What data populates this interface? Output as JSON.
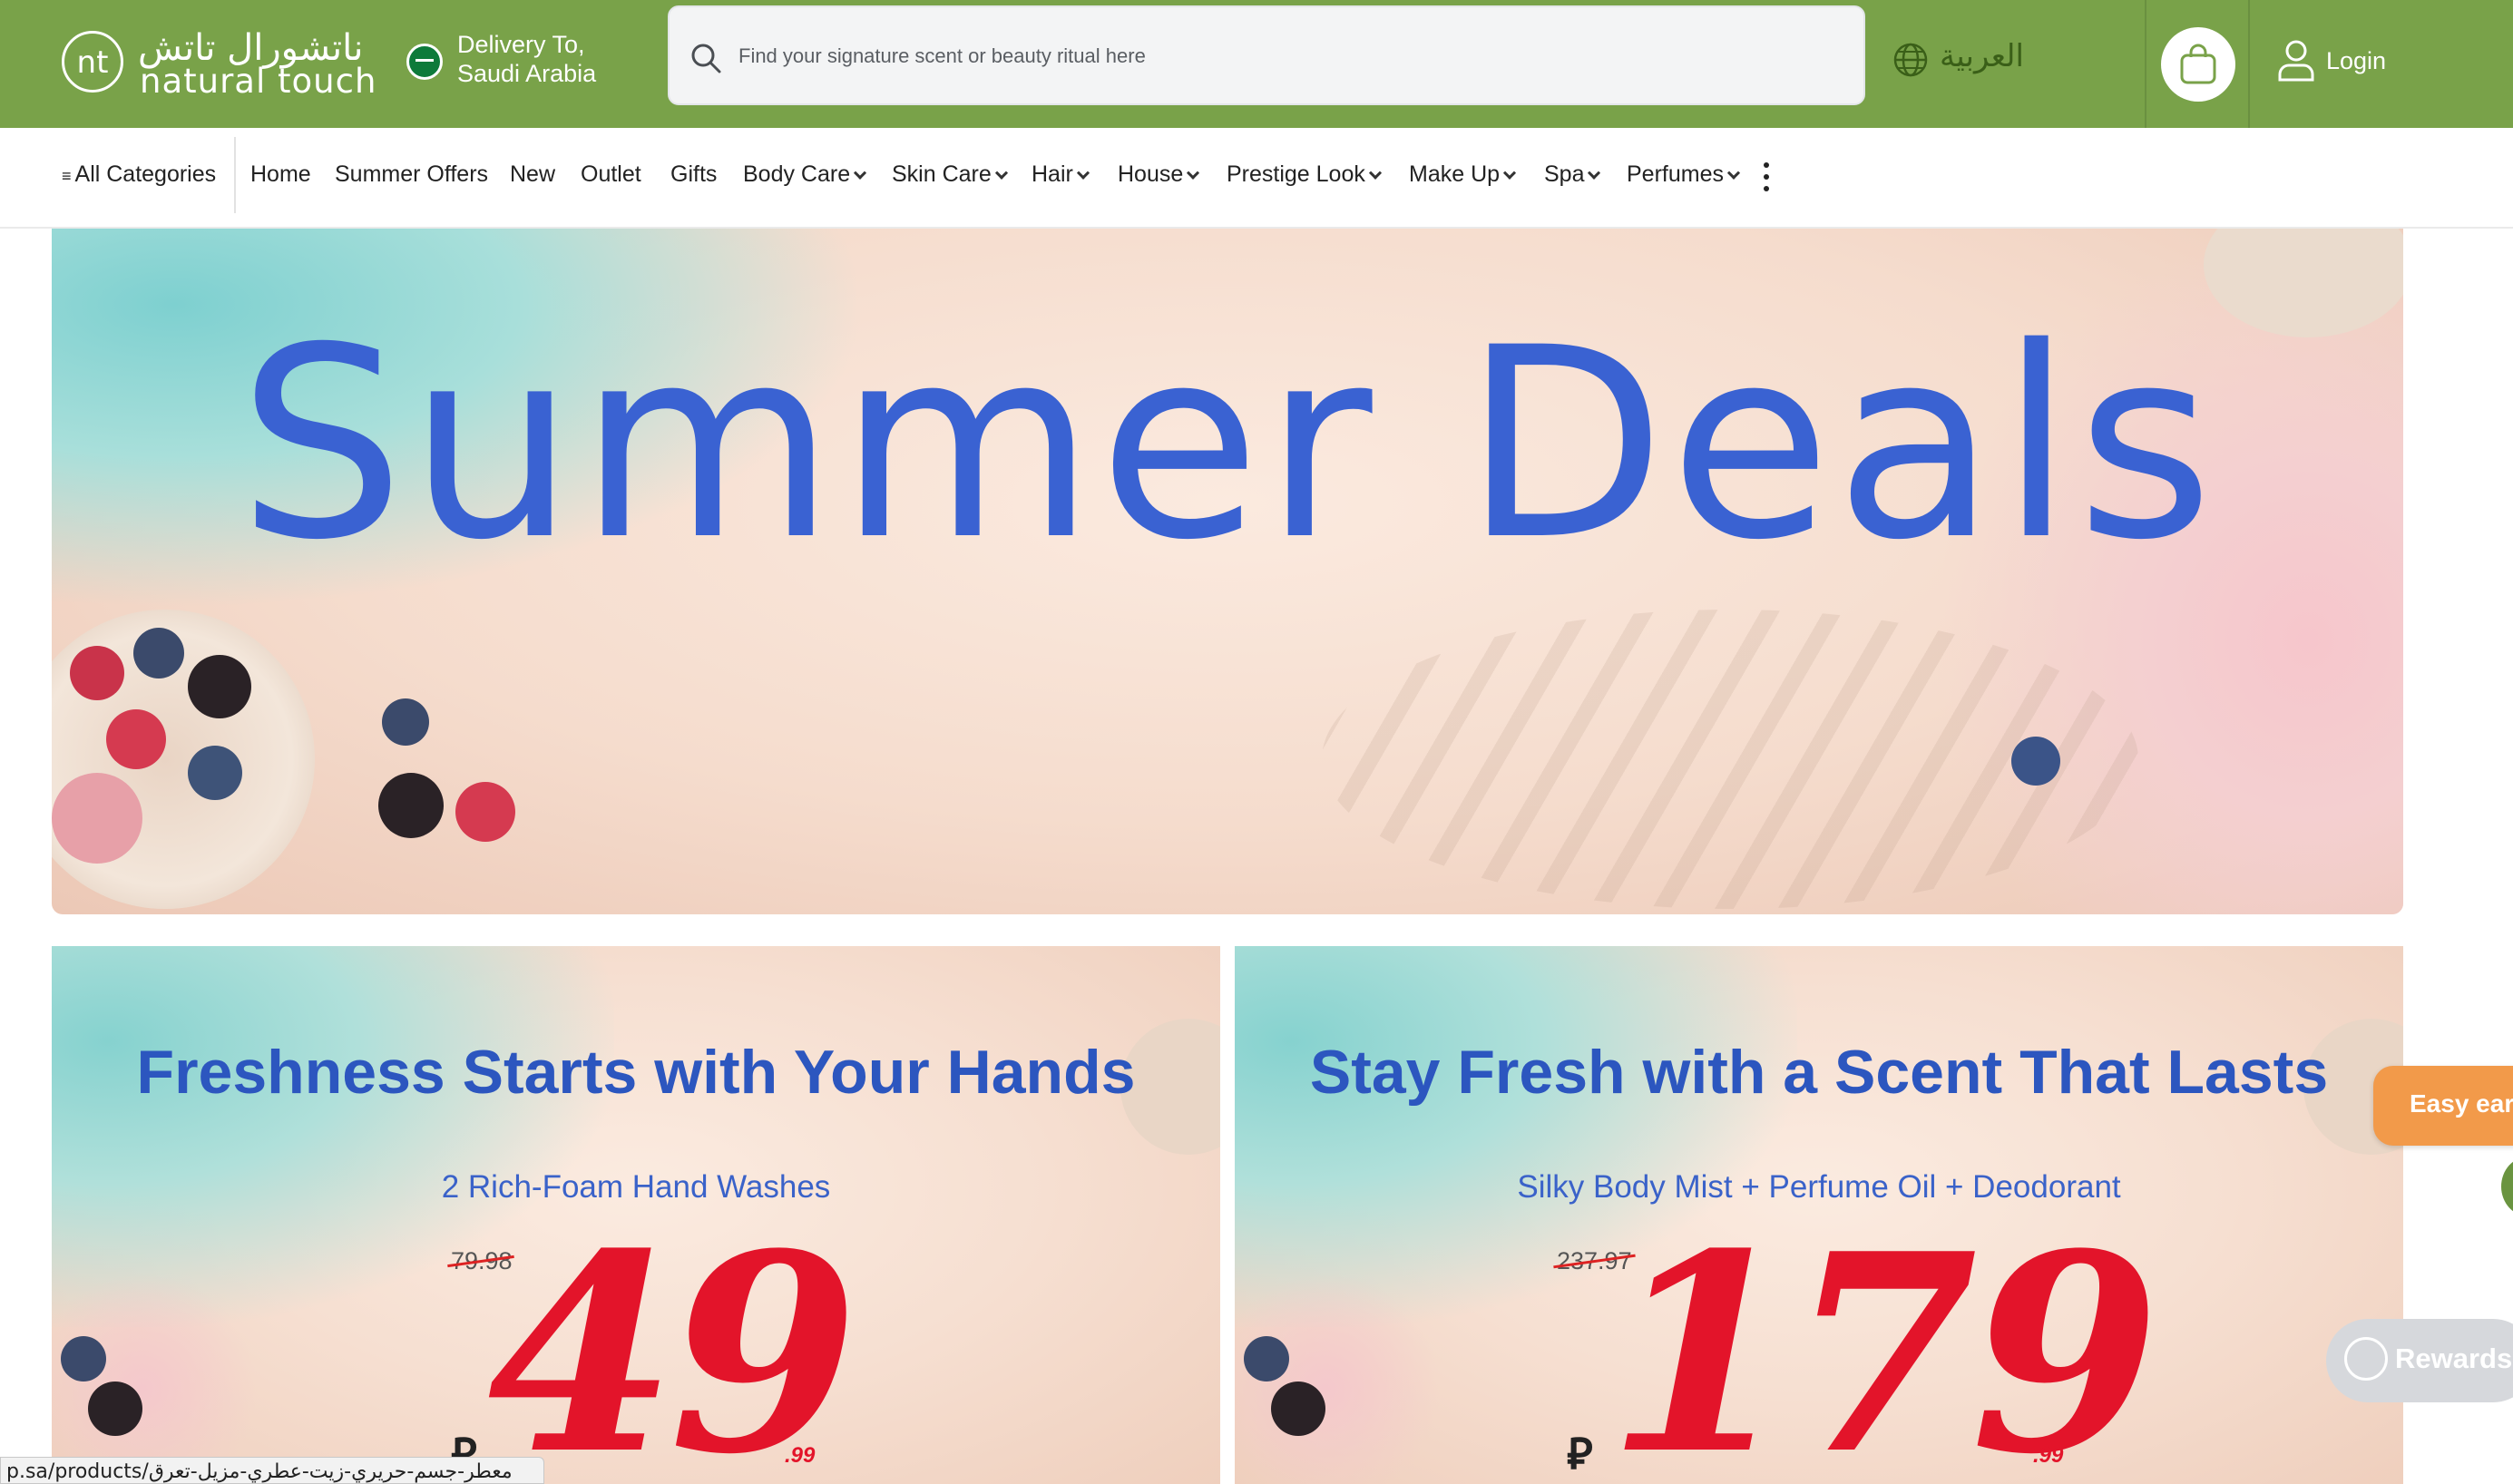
{
  "header": {
    "logo_text_ar": "ناتشورال تاتش",
    "logo_text_en": "natural touch",
    "logo_mark": "nt",
    "delivery_line1": "Delivery To,",
    "delivery_line2": "Saudi Arabia",
    "search_placeholder": "Find your signature scent or beauty ritual here",
    "language_label": "العربية",
    "login_label": "Login",
    "icons": [
      "search-icon",
      "globe-icon",
      "shopping-bag-icon",
      "user-icon",
      "saudi-flag-icon"
    ],
    "colors": {
      "header_bg": "#79a249",
      "accent_text": "#3a5f18"
    }
  },
  "nav": {
    "all_categories": "All Categories",
    "items": [
      {
        "label": "Home",
        "dropdown": false
      },
      {
        "label": "Summer Offers",
        "dropdown": false
      },
      {
        "label": "New",
        "dropdown": false
      },
      {
        "label": "Outlet",
        "dropdown": false
      },
      {
        "label": "Gifts",
        "dropdown": false
      },
      {
        "label": "Body Care",
        "dropdown": true
      },
      {
        "label": "Skin Care",
        "dropdown": true
      },
      {
        "label": "Hair",
        "dropdown": true
      },
      {
        "label": "House",
        "dropdown": true
      },
      {
        "label": "Prestige Look",
        "dropdown": true
      },
      {
        "label": "Make Up",
        "dropdown": true
      },
      {
        "label": "Spa",
        "dropdown": true
      },
      {
        "label": "Perfumes",
        "dropdown": true
      }
    ]
  },
  "hero": {
    "title": "Summer Deals",
    "title_color": "#3a62d2"
  },
  "promos": [
    {
      "title": "Freshness Starts with Your Hands",
      "subtitle": "2 Rich-Foam Hand Washes",
      "old_price": "79.98",
      "price": "49",
      "cents": ".99",
      "currency": "⃁"
    },
    {
      "title": "Stay Fresh with a Scent That Lasts",
      "subtitle": "Silky Body Mist + Perfume Oil + Deodorant",
      "old_price": "237.97",
      "price": "179",
      "cents": ".99",
      "currency": "⃁"
    }
  ],
  "widgets": {
    "easy_earn": "Easy earn",
    "rewards": "Rewards"
  },
  "status_bar": {
    "url": "p.sa/products/معطر-جسم-حريري-زيت-عطري-مزيل-تعرق"
  },
  "colors": {
    "price_red": "#e3142a",
    "promo_title_blue": "#2c56bf",
    "easy_earn_orange": "#f29a4a"
  }
}
